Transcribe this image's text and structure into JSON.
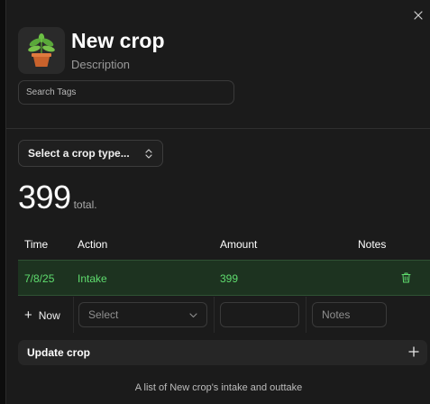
{
  "crop": {
    "title": "New crop",
    "description": "Description",
    "avatar_icon": "potted-plant-icon"
  },
  "tags": {
    "placeholder": "Search Tags",
    "value": ""
  },
  "crop_type": {
    "selected": "Select a crop type..."
  },
  "summary": {
    "total": "399",
    "total_label": "total."
  },
  "table": {
    "columns": [
      "Time",
      "Action",
      "Amount",
      "Notes"
    ],
    "rows": [
      {
        "time": "7/8/25",
        "action": "Intake",
        "amount": "399",
        "notes": ""
      }
    ],
    "new_row": {
      "now_label": "Now",
      "action_placeholder": "Select",
      "amount_value": "",
      "notes_placeholder": "Notes"
    }
  },
  "update": {
    "label": "Update crop"
  },
  "caption": "A list of New crop's intake and outtake",
  "colors": {
    "accent_green": "#5fdc6e",
    "row_highlight": "#1d3320",
    "panel_bg": "#1b1b1b"
  }
}
